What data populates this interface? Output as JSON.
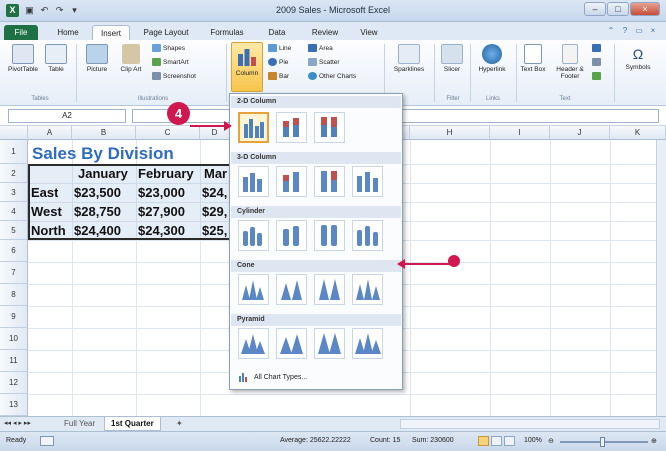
{
  "window": {
    "title": "2009 Sales - Microsoft Excel",
    "app_icon": "X"
  },
  "tabs": [
    "File",
    "Home",
    "Insert",
    "Page Layout",
    "Formulas",
    "Data",
    "Review",
    "View"
  ],
  "ribbon": {
    "pivot": "PivotTable",
    "table": "Table",
    "picture": "Picture",
    "clipart": "Clip Art",
    "shapes": "Shapes",
    "smartart": "SmartArt",
    "screenshot": "Screenshot",
    "column": "Column",
    "line": "Line",
    "pie": "Pie",
    "bar": "Bar",
    "area": "Area",
    "scatter": "Scatter",
    "other_charts": "Other Charts",
    "sparklines": "Sparklines",
    "slicer": "Slicer",
    "hyperlink": "Hyperlink",
    "textbox": "Text Box",
    "header_footer": "Header & Footer",
    "symbols": "Symbols",
    "groups": {
      "tables": "Tables",
      "illustrations": "Illustrations",
      "filter": "Filter",
      "links": "Links",
      "text": "Text"
    }
  },
  "formula_bar": {
    "name_box": "A2",
    "fx_symbol": "fx"
  },
  "columns": [
    "A",
    "B",
    "C",
    "D",
    "E",
    "F",
    "G",
    "H",
    "I",
    "J",
    "K"
  ],
  "rows": [
    "1",
    "2",
    "3",
    "4",
    "5",
    "6",
    "7",
    "8",
    "9",
    "10",
    "11",
    "12",
    "13"
  ],
  "sheet": {
    "title": "Sales By Division",
    "headers": [
      "January",
      "February",
      "Mar"
    ],
    "data": [
      {
        "division": "East",
        "values": [
          "$23,500",
          "$23,000",
          "$24,"
        ]
      },
      {
        "division": "West",
        "values": [
          "$28,750",
          "$27,900",
          "$29,"
        ]
      },
      {
        "division": "North",
        "values": [
          "$24,400",
          "$24,300",
          "$25,"
        ]
      }
    ]
  },
  "dropdown": {
    "sections": [
      "2-D Column",
      "3-D Column",
      "Cylinder",
      "Cone",
      "Pyramid"
    ],
    "all_chart_types": "All Chart Types..."
  },
  "sheet_tabs": [
    "Full Year",
    "1st Quarter"
  ],
  "status": {
    "ready": "Ready",
    "average": "Average: 25622.22222",
    "count": "Count: 15",
    "sum": "Sum: 230600",
    "zoom": "100%"
  },
  "callout": {
    "step": "4"
  },
  "colors": {
    "accent": "#d0174f",
    "title_blue": "#2f6cbf",
    "excel_green": "#1e7145"
  }
}
